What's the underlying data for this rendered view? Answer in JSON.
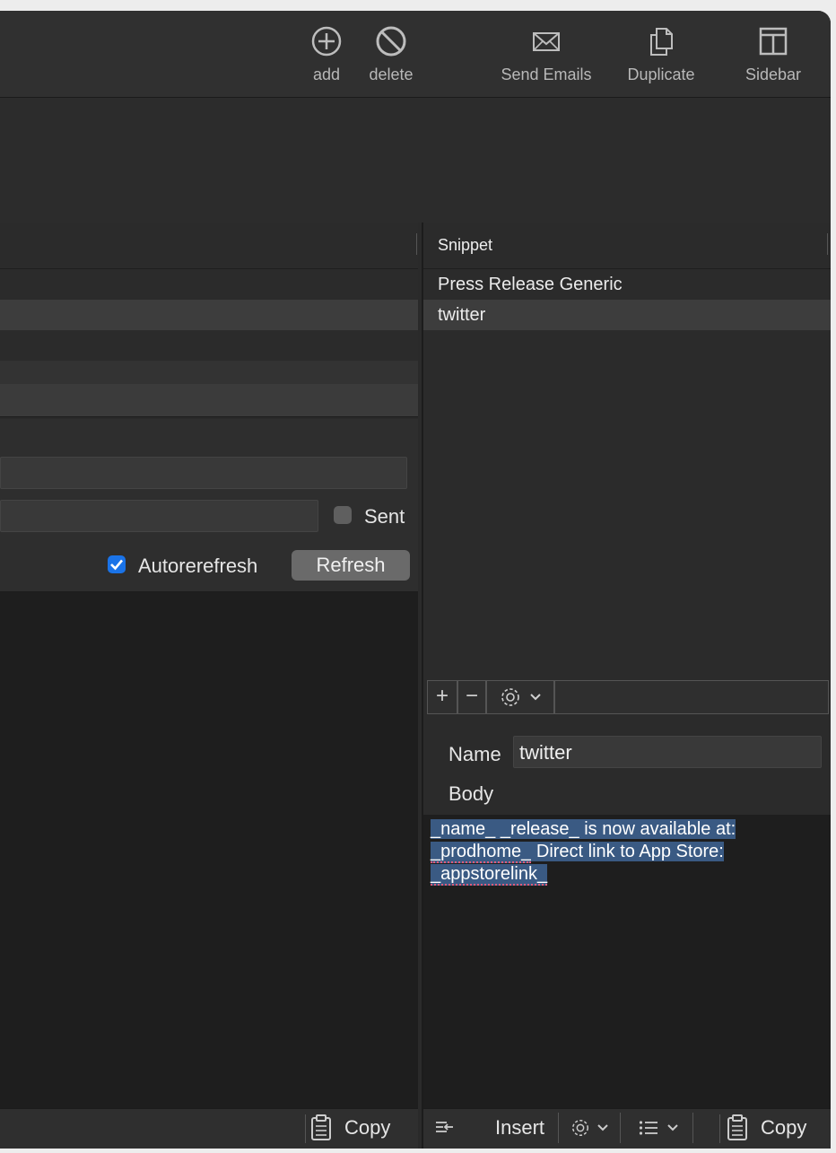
{
  "toolbar": {
    "add_label": "add",
    "delete_label": "delete",
    "send_emails_label": "Send Emails",
    "duplicate_label": "Duplicate",
    "sidebar_label": "Sidebar"
  },
  "left": {
    "sent_label": "Sent",
    "autorefresh_label": "Autorerefresh",
    "autorefresh_checked": true,
    "refresh_label": "Refresh",
    "copy_label": "Copy"
  },
  "snippets": {
    "column_header": "Snippet",
    "items": [
      {
        "label": "Press Release Generic"
      },
      {
        "label": "twitter",
        "selected": true
      }
    ]
  },
  "editor": {
    "name_label": "Name",
    "name_value": "twitter",
    "body_label": "Body",
    "body_line1": "_name_ _release_ is now available at:",
    "body_line2a": "_prodhome_",
    "body_line2b": " Direct link to App Store:",
    "body_line3": "_appstorelink_"
  },
  "bottom_right": {
    "insert_label": "Insert",
    "copy_label": "Copy"
  },
  "colors": {
    "accent": "#1a73e8",
    "selection": "#3a5a83",
    "window_bg": "#2b2b2b"
  }
}
